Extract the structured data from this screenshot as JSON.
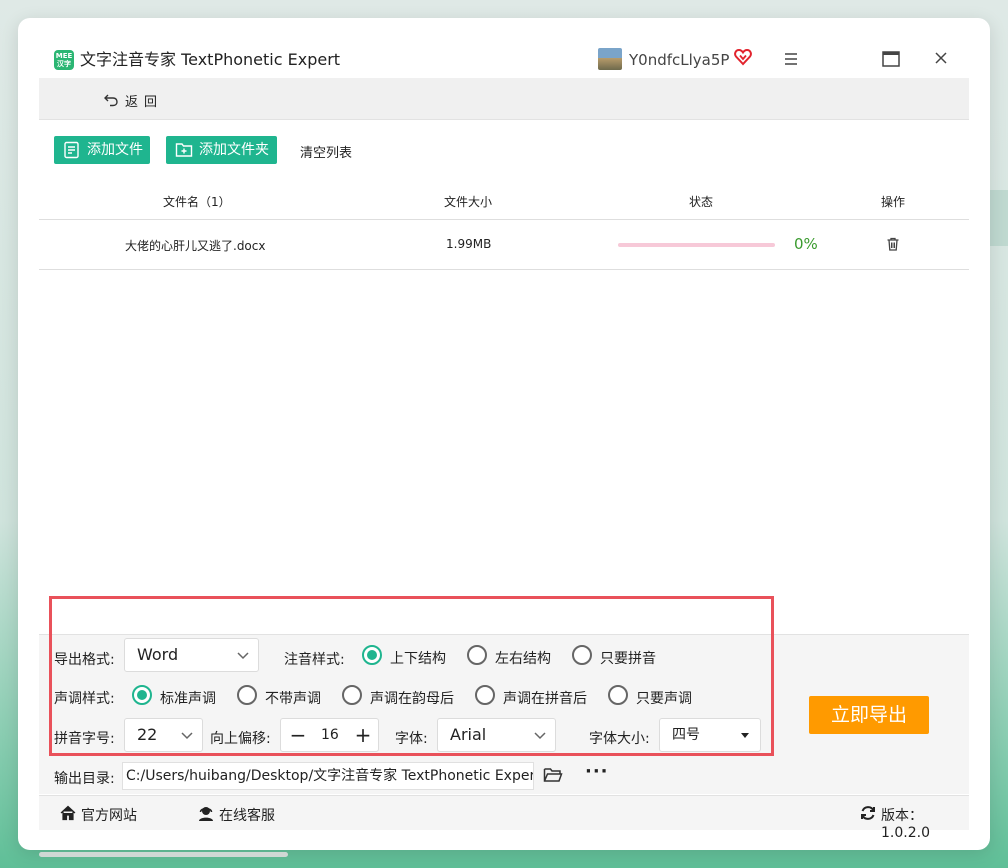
{
  "window": {
    "title": "文字注音专家 TextPhonetic Expert",
    "logo_text": "MEE 汉字",
    "username": "Y0ndfcLlya5P"
  },
  "toolbar": {
    "back_label": "返回",
    "add_file_label": "添加文件",
    "add_folder_label": "添加文件夹",
    "clear_list_label": "清空列表"
  },
  "table": {
    "headers": {
      "filename": "文件名（1）",
      "size": "文件大小",
      "status": "状态",
      "action": "操作"
    },
    "rows": [
      {
        "filename": "大佬的心肝儿又逃了.docx",
        "size": "1.99MB",
        "progress": 0,
        "progress_label": "0%"
      }
    ]
  },
  "settings": {
    "export_format_label": "导出格式:",
    "export_format_value": "Word",
    "annotation_style_label": "注音样式:",
    "annotation_styles": [
      "上下结构",
      "左右结构",
      "只要拼音"
    ],
    "annotation_style_selected": "上下结构",
    "tone_style_label": "声调样式:",
    "tone_styles": [
      "标准声调",
      "不带声调",
      "声调在韵母后",
      "声调在拼音后",
      "只要声调"
    ],
    "tone_style_selected": "标准声调",
    "pinyin_size_label": "拼音字号:",
    "pinyin_size_value": "22",
    "offset_label": "向上偏移:",
    "offset_value": "16",
    "font_label": "字体:",
    "font_value": "Arial",
    "font_size_label": "字体大小:",
    "font_size_value": "四号"
  },
  "export_button_label": "立即导出",
  "output": {
    "label": "输出目录:",
    "path": "C:/Users/huibang/Desktop/文字注音专家 TextPhonetic Expert"
  },
  "footer": {
    "website": "官方网站",
    "support": "在线客服",
    "version": "版本：1.0.2.0"
  },
  "colors": {
    "accent_green": "#1fb58f",
    "export_orange": "#ff9a00",
    "highlight_red": "#e9515a",
    "progress_pink": "#f7c9d8",
    "percent_green": "#3a9b2e"
  }
}
